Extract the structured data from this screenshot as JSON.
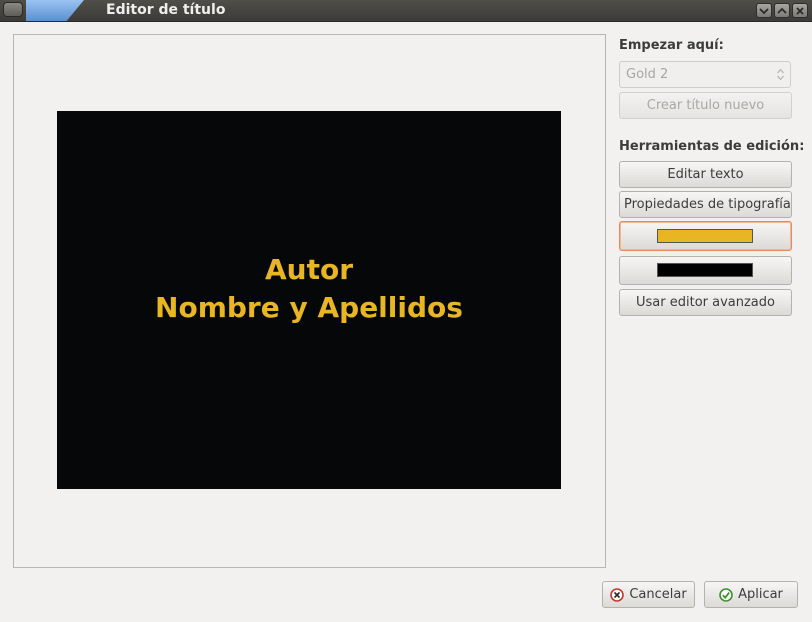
{
  "window": {
    "title": "Editor de título",
    "controls": [
      "minimize-icon",
      "maximize-icon",
      "close-icon"
    ]
  },
  "preview": {
    "lines": [
      "Autor",
      "Nombre y Apellidos"
    ],
    "text_color": "#e8b523",
    "background_color": "#060708"
  },
  "sidebar": {
    "start_label": "Empezar aquí:",
    "template_select": {
      "value": "Gold 2",
      "enabled": false
    },
    "new_title_button": "Crear título nuevo",
    "tools_label": "Herramientas de edición:",
    "edit_text_button": "Editar texto",
    "font_props_button": "Propiedades de tipografía",
    "text_color_swatch": "#e8b523",
    "bg_color_swatch": "#000000",
    "advanced_editor_button": "Usar editor avanzado"
  },
  "footer": {
    "cancel_label": "Cancelar",
    "apply_label": "Aplicar"
  }
}
